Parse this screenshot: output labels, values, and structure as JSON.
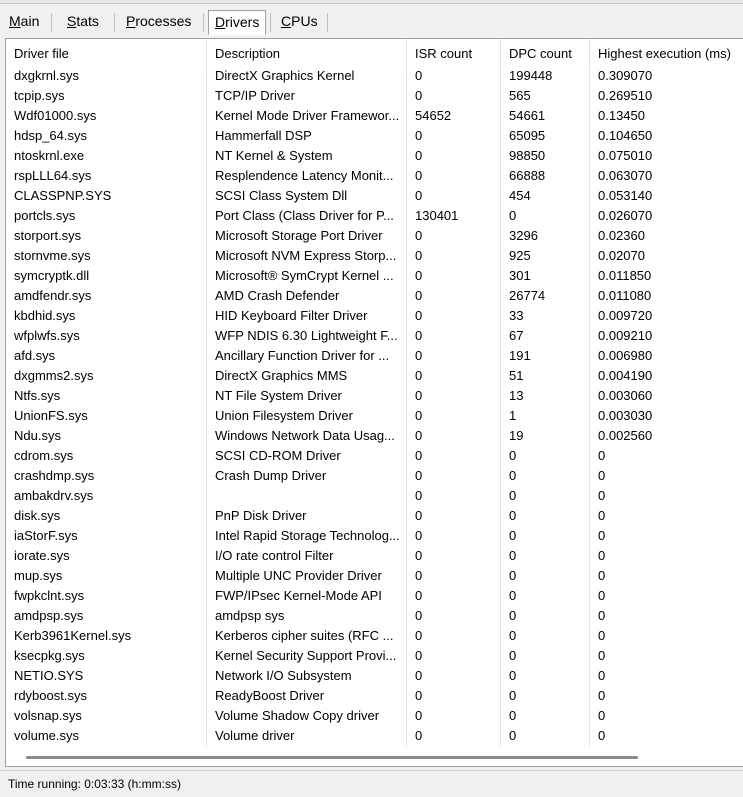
{
  "tabs": [
    {
      "label": "Main"
    },
    {
      "label": "Stats"
    },
    {
      "label": "Processes"
    },
    {
      "label": "Drivers"
    },
    {
      "label": "CPUs"
    }
  ],
  "active_tab": "Drivers",
  "table": {
    "columns": [
      "Driver file",
      "Description",
      "ISR count",
      "DPC count",
      "Highest execution (ms)"
    ],
    "rows": [
      [
        "dxgkrnl.sys",
        "DirectX Graphics Kernel",
        "0",
        "199448",
        "0.309070"
      ],
      [
        "tcpip.sys",
        "TCP/IP Driver",
        "0",
        "565",
        "0.269510"
      ],
      [
        "Wdf01000.sys",
        "Kernel Mode Driver Framewor...",
        "54652",
        "54661",
        "0.13450"
      ],
      [
        "hdsp_64.sys",
        "Hammerfall DSP",
        "0",
        "65095",
        "0.104650"
      ],
      [
        "ntoskrnl.exe",
        "NT Kernel & System",
        "0",
        "98850",
        "0.075010"
      ],
      [
        "rspLLL64.sys",
        "Resplendence Latency Monit...",
        "0",
        "66888",
        "0.063070"
      ],
      [
        "CLASSPNP.SYS",
        "SCSI Class System Dll",
        "0",
        "454",
        "0.053140"
      ],
      [
        "portcls.sys",
        "Port Class (Class Driver for P...",
        "130401",
        "0",
        "0.026070"
      ],
      [
        "storport.sys",
        "Microsoft Storage Port Driver",
        "0",
        "3296",
        "0.02360"
      ],
      [
        "stornvme.sys",
        "Microsoft NVM Express Storp...",
        "0",
        "925",
        "0.02070"
      ],
      [
        "symcryptk.dll",
        "Microsoft® SymCrypt Kernel ...",
        "0",
        "301",
        "0.011850"
      ],
      [
        "amdfendr.sys",
        "AMD Crash Defender",
        "0",
        "26774",
        "0.011080"
      ],
      [
        "kbdhid.sys",
        "HID Keyboard Filter Driver",
        "0",
        "33",
        "0.009720"
      ],
      [
        "wfplwfs.sys",
        "WFP NDIS 6.30 Lightweight F...",
        "0",
        "67",
        "0.009210"
      ],
      [
        "afd.sys",
        "Ancillary Function Driver for ...",
        "0",
        "191",
        "0.006980"
      ],
      [
        "dxgmms2.sys",
        "DirectX Graphics MMS",
        "0",
        "51",
        "0.004190"
      ],
      [
        "Ntfs.sys",
        "NT File System Driver",
        "0",
        "13",
        "0.003060"
      ],
      [
        "UnionFS.sys",
        "Union Filesystem Driver",
        "0",
        "1",
        "0.003030"
      ],
      [
        "Ndu.sys",
        "Windows Network Data Usag...",
        "0",
        "19",
        "0.002560"
      ],
      [
        "cdrom.sys",
        "SCSI CD-ROM Driver",
        "0",
        "0",
        "0"
      ],
      [
        "crashdmp.sys",
        "Crash Dump Driver",
        "0",
        "0",
        "0"
      ],
      [
        "ambakdrv.sys",
        "",
        "0",
        "0",
        "0"
      ],
      [
        "disk.sys",
        "PnP Disk Driver",
        "0",
        "0",
        "0"
      ],
      [
        "iaStorF.sys",
        "Intel Rapid Storage Technolog...",
        "0",
        "0",
        "0"
      ],
      [
        "iorate.sys",
        "I/O rate control Filter",
        "0",
        "0",
        "0"
      ],
      [
        "mup.sys",
        "Multiple UNC Provider Driver",
        "0",
        "0",
        "0"
      ],
      [
        "fwpkclnt.sys",
        "FWP/IPsec Kernel-Mode API",
        "0",
        "0",
        "0"
      ],
      [
        "amdpsp.sys",
        "amdpsp sys",
        "0",
        "0",
        "0"
      ],
      [
        "Kerb3961Kernel.sys",
        "Kerberos cipher suites (RFC ...",
        "0",
        "0",
        "0"
      ],
      [
        "ksecpkg.sys",
        "Kernel Security Support Provi...",
        "0",
        "0",
        "0"
      ],
      [
        "NETIO.SYS",
        "Network I/O Subsystem",
        "0",
        "0",
        "0"
      ],
      [
        "rdyboost.sys",
        "ReadyBoost Driver",
        "0",
        "0",
        "0"
      ],
      [
        "volsnap.sys",
        "Volume Shadow Copy driver",
        "0",
        "0",
        "0"
      ],
      [
        "volume.sys",
        "Volume driver",
        "0",
        "0",
        "0"
      ]
    ]
  },
  "status": {
    "text": "Time running: 0:03:33  (h:mm:ss)"
  }
}
